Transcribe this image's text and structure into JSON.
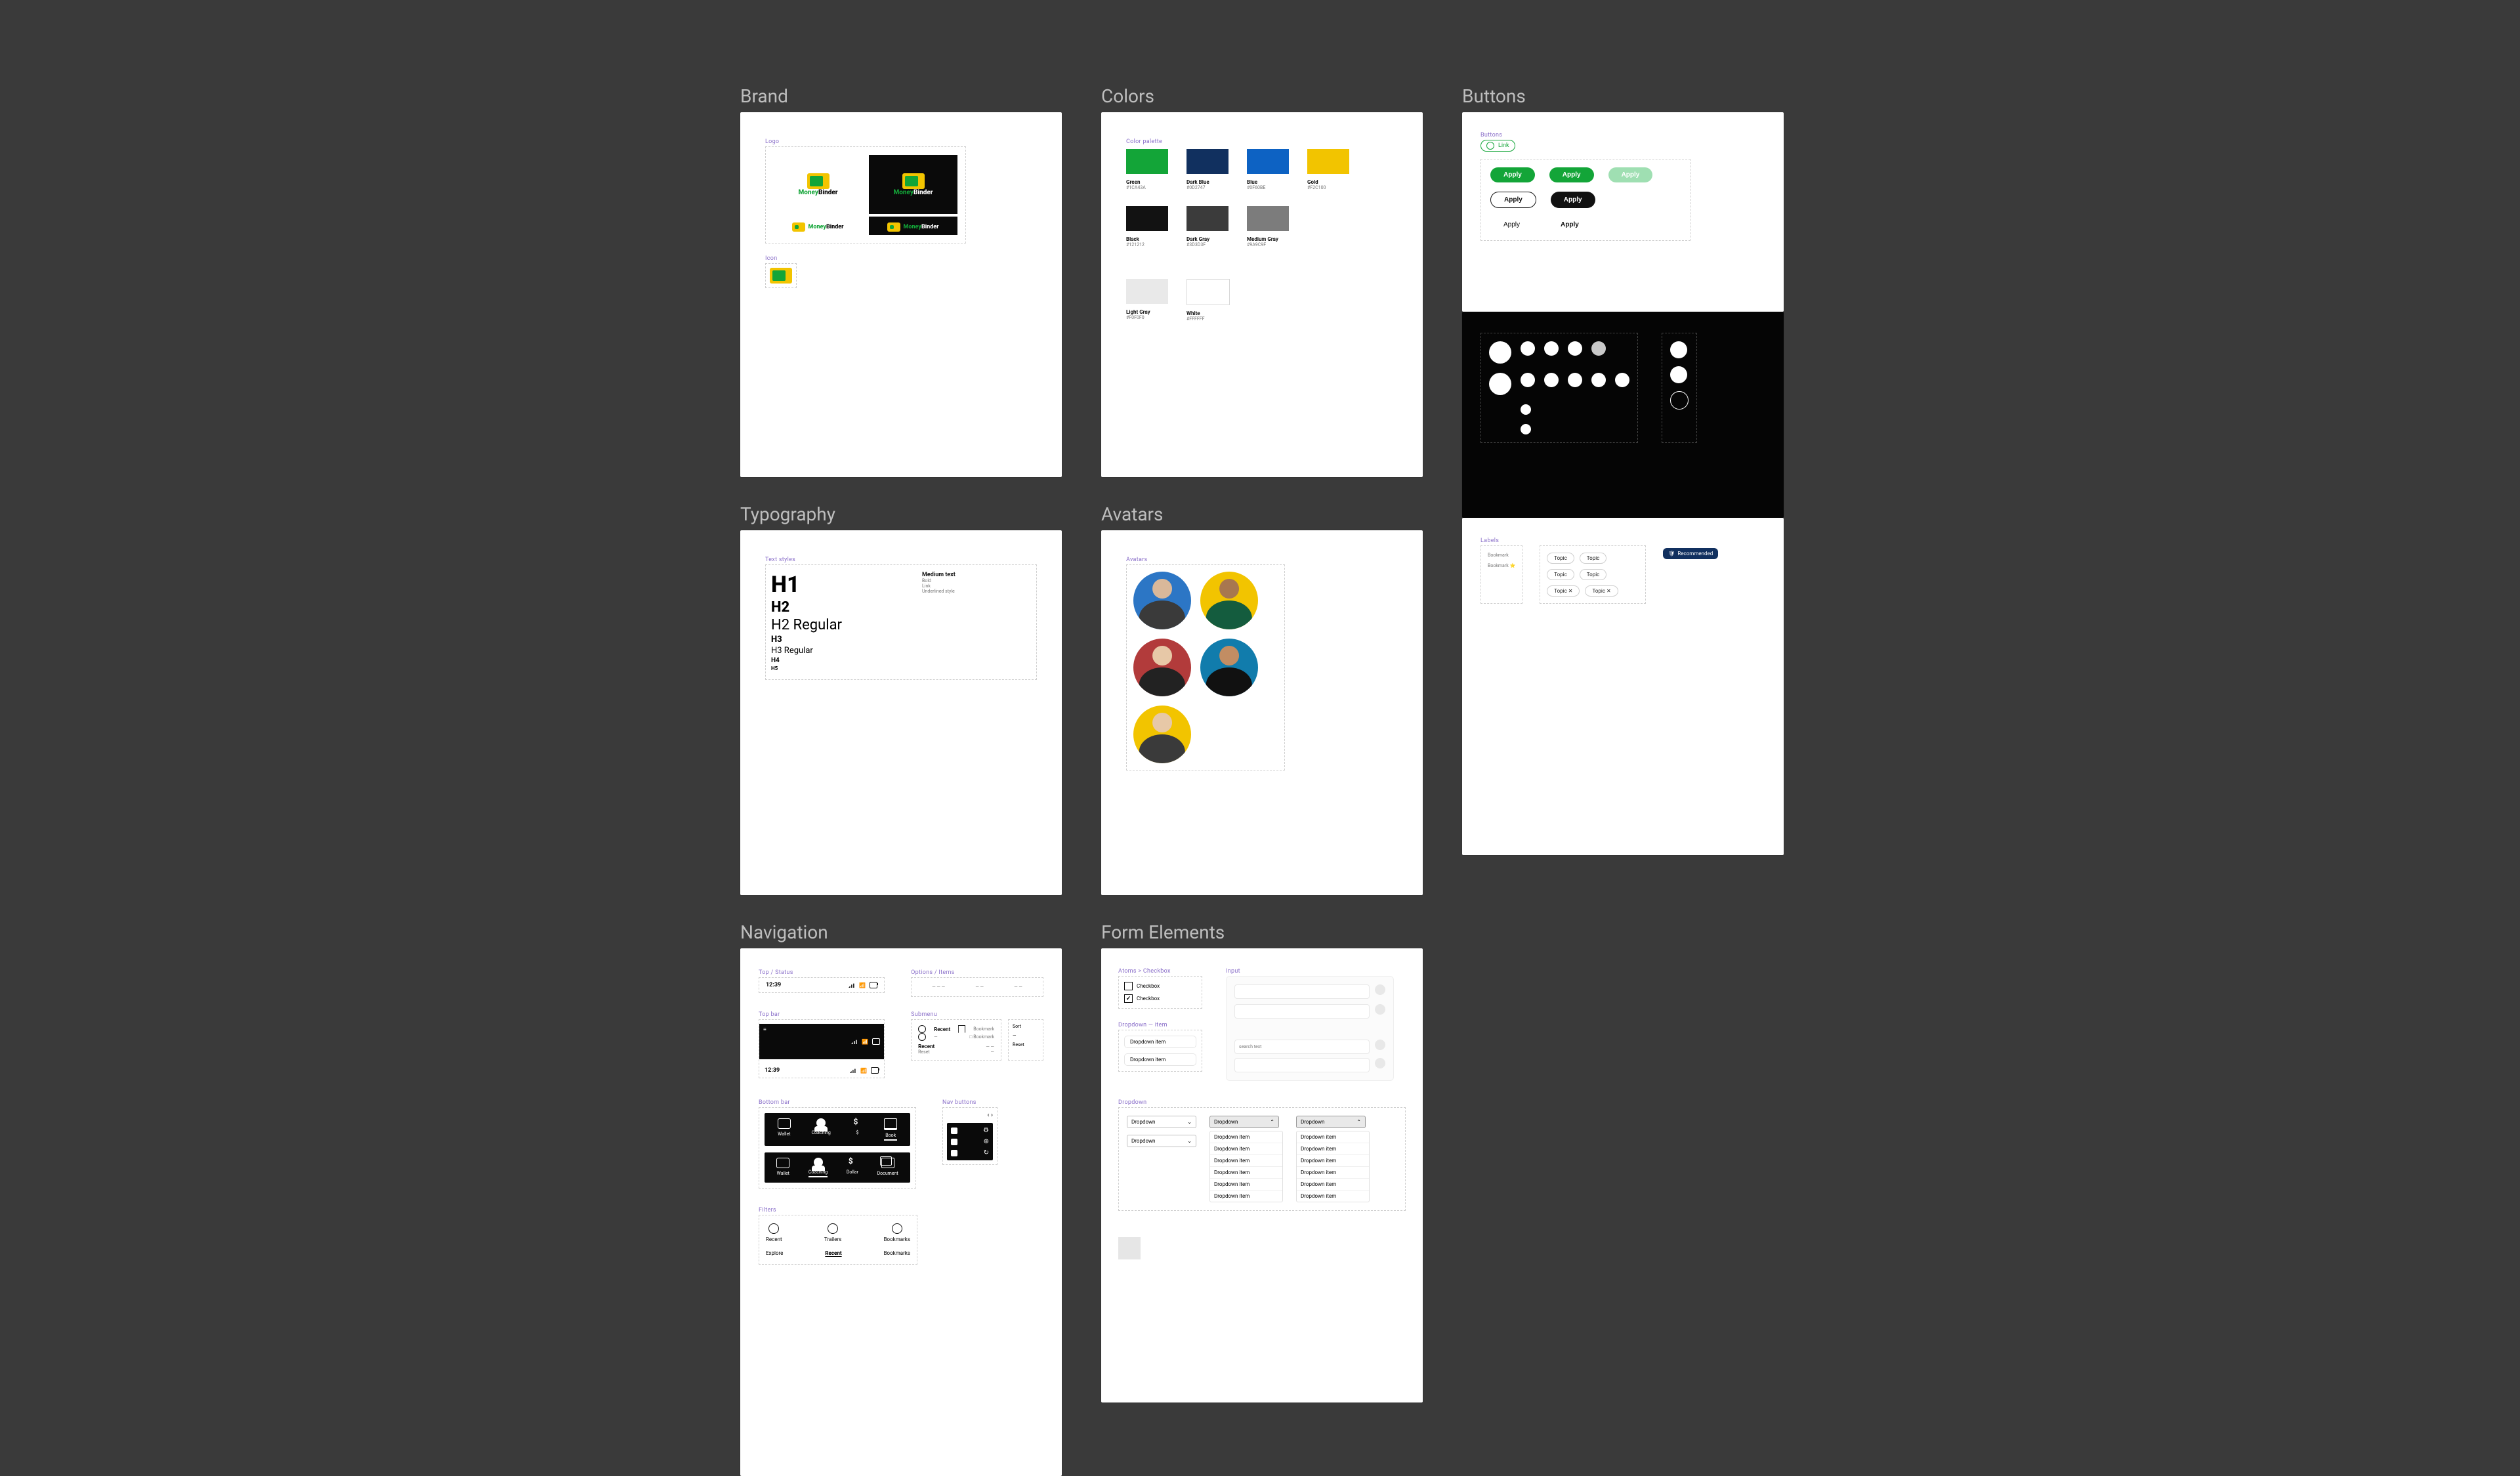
{
  "sections": {
    "brand": "Brand",
    "colors": "Colors",
    "typography": "Typography",
    "avatars": "Avatars",
    "buttons": "Buttons",
    "navigation": "Navigation",
    "form": "Form Elements"
  },
  "brand": {
    "logoSection": "Logo",
    "iconSection": "Icon",
    "name": "MoneyBinder",
    "nameA": "Money",
    "nameB": "Binder"
  },
  "colors": {
    "sect": "Color palette",
    "items": [
      {
        "name": "Green",
        "hex": "#1CA43A"
      },
      {
        "name": "Dark Blue",
        "hex": "#0D2747"
      },
      {
        "name": "Blue",
        "hex": "#0F60BE"
      },
      {
        "name": "Gold",
        "hex": "#F2C100"
      },
      {
        "name": "Black",
        "hex": "#121212"
      },
      {
        "name": "Dark Gray",
        "hex": "#3D3D3F"
      },
      {
        "name": "Medium Gray",
        "hex": "#9A9C9F"
      },
      {
        "name": "Light Gray",
        "hex": "#F0F0F0"
      },
      {
        "name": "White",
        "hex": "#FFFFFF"
      }
    ]
  },
  "typo": {
    "sect": "Text styles",
    "h1": "H1",
    "h2": "H2",
    "h2r": "H2 Regular",
    "h3": "H3",
    "h3r": "H3 Regular",
    "h4": "H4",
    "h5": "H5",
    "rightHead": "Medium text",
    "rightItems": [
      "Bold",
      "Link",
      "Underlined style"
    ]
  },
  "avatars": {
    "sect": "Avatars"
  },
  "buttons": {
    "sect": "Buttons",
    "link": "Link",
    "apply": "Apply",
    "labelsSect": "Labels",
    "bookmark": "Bookmark",
    "bookmarkStar": "Bookmark ⭐",
    "topics": [
      "Topic",
      "Topic",
      "Topic",
      "Topic",
      "Topic ✕",
      "Topic ✕"
    ],
    "recommended": "Recommended"
  },
  "nav": {
    "topSect": "Top / Status",
    "modalSect": "Options / Items",
    "modalSectB": "Submenu",
    "bottomSect": "Bottom bar",
    "navSect": "Nav buttons",
    "filterSect": "Filters",
    "time": "12:39",
    "recent": "Recent",
    "bookmark": "Bookmark",
    "reset": "Reset",
    "tabs": [
      "Wallet",
      "Coaching",
      "$",
      "Book"
    ],
    "tabs2": [
      "Wallet",
      "Coaching",
      "Dollar",
      "Document"
    ],
    "filters": [
      "Recent",
      "Trailers",
      "Bookmarks"
    ],
    "filtersB": [
      "Explore",
      "Recent",
      "Bookmarks"
    ],
    "sort": "Sort",
    "reset2": "Reset"
  },
  "form": {
    "checkboxSect": "Atoms > Checkbox",
    "inputSect": "Input",
    "dropItemSect": "Dropdown — item",
    "dropSect": "Dropdown",
    "checkbox": "Checkbox",
    "dropdown": "Dropdown",
    "item": "Dropdown item",
    "search": "search text"
  }
}
